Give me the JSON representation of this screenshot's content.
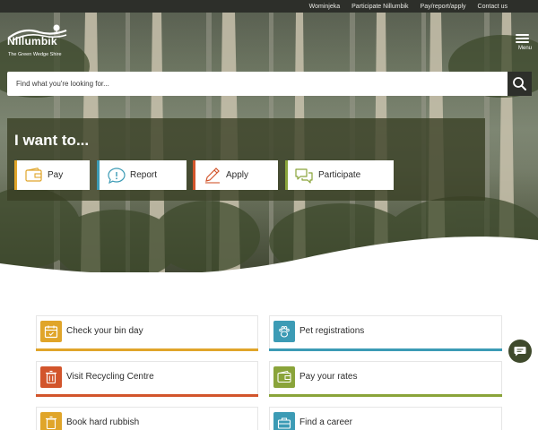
{
  "utility_nav": [
    "Wominjeka",
    "Participate Nillumbik",
    "Pay/report/apply",
    "Contact us"
  ],
  "logo": {
    "name": "Nillumbik",
    "tagline": "The Green Wedge Shire"
  },
  "menu": {
    "label": "Menu"
  },
  "search": {
    "placeholder": "Find what you're looking for...",
    "icon": "search-icon"
  },
  "iwant": {
    "title": "I want to...",
    "actions": [
      {
        "label": "Pay",
        "icon": "wallet-icon",
        "accent": "#e0a52a"
      },
      {
        "label": "Report",
        "icon": "speech-info-icon",
        "accent": "#3c9bb5"
      },
      {
        "label": "Apply",
        "icon": "pencil-icon",
        "accent": "#d2552c"
      },
      {
        "label": "Participate",
        "icon": "chat-bubbles-icon",
        "accent": "#8aa43a"
      }
    ]
  },
  "quick_links": [
    {
      "label": "Check your bin day",
      "icon": "calendar-icon",
      "color": "#e0a52a"
    },
    {
      "label": "Pet registrations",
      "icon": "paw-icon",
      "color": "#3c9bb5"
    },
    {
      "label": "Visit Recycling Centre",
      "icon": "bin-icon",
      "color": "#d2552c"
    },
    {
      "label": "Pay your rates",
      "icon": "wallet-icon",
      "color": "#8aa43a"
    },
    {
      "label": "Book hard rubbish",
      "icon": "bin-icon",
      "color": "#e0a52a"
    },
    {
      "label": "Find a career",
      "icon": "briefcase-icon",
      "color": "#3c9bb5"
    }
  ],
  "chat": {
    "icon": "chat-icon"
  }
}
